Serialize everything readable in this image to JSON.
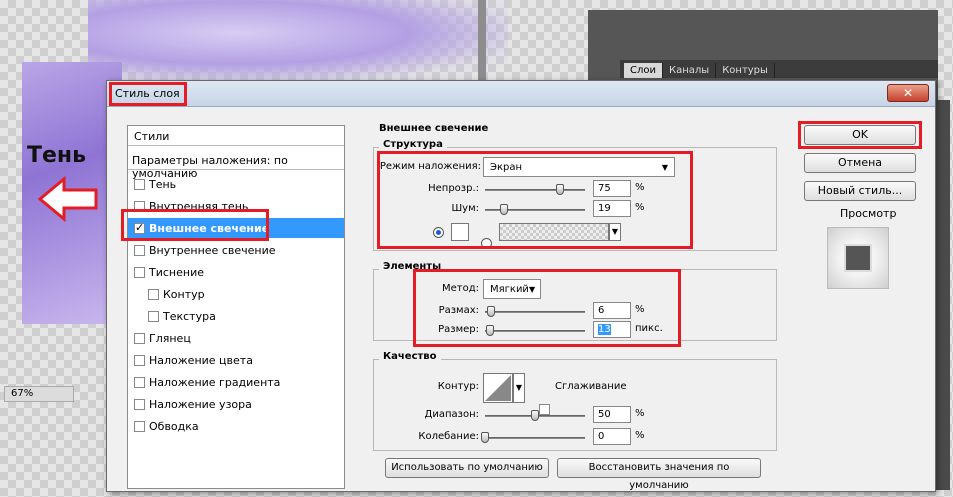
{
  "background": {
    "zoom": "67%",
    "annotation_label": "Тень",
    "panel_tabs": [
      "Слои",
      "Каналы",
      "Контуры"
    ]
  },
  "dialog": {
    "title": "Стиль слоя",
    "close": "✕",
    "styles": {
      "header": "Стили",
      "blend_defaults": "Параметры наложения: по умолчанию",
      "items": [
        {
          "label": "Тень",
          "checked": false
        },
        {
          "label": "Внутренняя тень",
          "checked": false
        },
        {
          "label": "Внешнее свечение",
          "checked": true
        },
        {
          "label": "Внутреннее свечение",
          "checked": false
        },
        {
          "label": "Тиснение",
          "checked": false
        },
        {
          "label": "Контур",
          "checked": false
        },
        {
          "label": "Текстура",
          "checked": false
        },
        {
          "label": "Глянец",
          "checked": false
        },
        {
          "label": "Наложение цвета",
          "checked": false
        },
        {
          "label": "Наложение градиента",
          "checked": false
        },
        {
          "label": "Наложение узора",
          "checked": false
        },
        {
          "label": "Обводка",
          "checked": false
        }
      ]
    },
    "main": {
      "section_title": "Внешнее свечение",
      "structure": {
        "label": "Структура",
        "blend_mode_label": "Режим наложения:",
        "blend_mode_value": "Экран",
        "opacity_label": "Непрозр.:",
        "opacity_value": "75",
        "opacity_unit": "%",
        "noise_label": "Шум:",
        "noise_value": "19",
        "noise_unit": "%",
        "opacity_fraction": 0.75,
        "noise_fraction": 0.19
      },
      "elements": {
        "label": "Элементы",
        "method_label": "Метод:",
        "method_value": "Мягкий",
        "spread_label": "Размах:",
        "spread_value": "6",
        "spread_unit": "%",
        "size_label": "Размер:",
        "size_value": "13",
        "size_unit": "пикс.",
        "spread_fraction": 0.06,
        "size_fraction": 0.05
      },
      "quality": {
        "label": "Качество",
        "contour_label": "Контур:",
        "antialias_label": "Сглаживание",
        "range_label": "Диапазон:",
        "range_value": "50",
        "range_unit": "%",
        "jitter_label": "Колебание:",
        "jitter_value": "0",
        "jitter_unit": "%",
        "range_fraction": 0.5,
        "jitter_fraction": 0.0
      },
      "default_button": "Использовать по умолчанию",
      "reset_button": "Восстановить значения по умолчанию"
    },
    "buttons": {
      "ok": "OK",
      "cancel": "Отмена",
      "new_style": "Новый стиль...",
      "preview_label": "Просмотр"
    }
  },
  "colors": {
    "highlight_red": "#e41c25",
    "selection_blue": "#3399ff"
  }
}
